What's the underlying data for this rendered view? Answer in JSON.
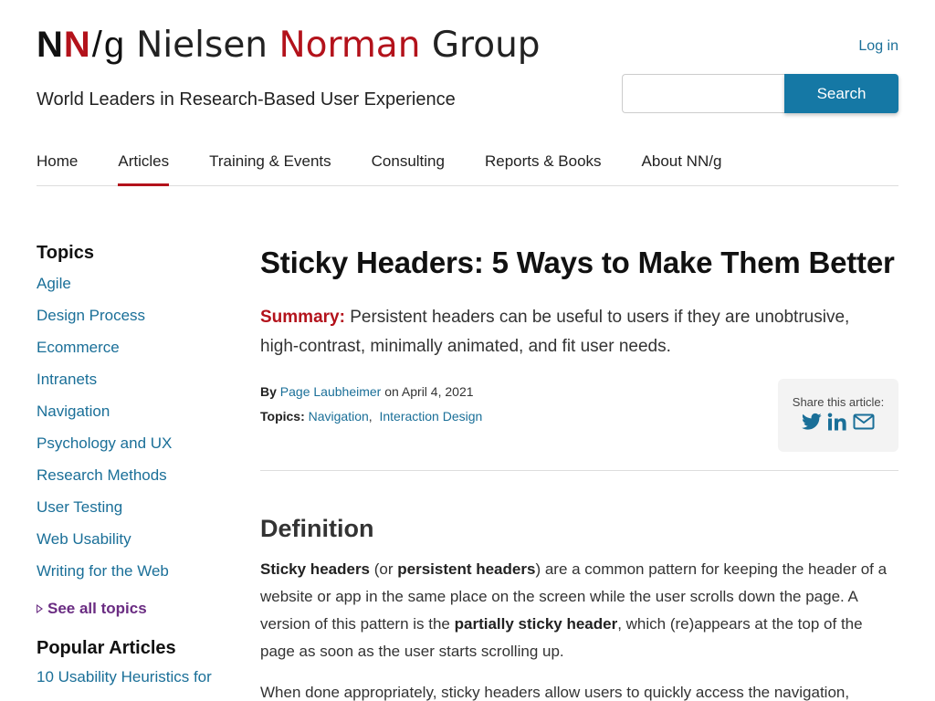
{
  "header": {
    "logo_mark": {
      "n1": "N",
      "n2": "N",
      "slash": "/",
      "g": "g"
    },
    "logo_text": {
      "part1": "Nielsen ",
      "part2": "Norman",
      "part3": " Group"
    },
    "tagline": "World Leaders in Research-Based User Experience",
    "login": "Log in",
    "search": {
      "placeholder": "",
      "button": "Search"
    }
  },
  "nav": {
    "items": [
      "Home",
      "Articles",
      "Training & Events",
      "Consulting",
      "Reports & Books",
      "About NN/g"
    ],
    "active": "Articles"
  },
  "sidebar": {
    "topics_heading": "Topics",
    "topics": [
      "Agile",
      "Design Process",
      "Ecommerce",
      "Intranets",
      "Navigation",
      "Psychology and UX",
      "Research Methods",
      "User Testing",
      "Web Usability",
      "Writing for the Web"
    ],
    "see_all": "See all topics",
    "popular_heading": "Popular Articles",
    "popular_first": "10 Usability Heuristics for"
  },
  "article": {
    "title": "Sticky Headers: 5 Ways to Make Them Better",
    "summary_label": "Summary:",
    "summary_text": "Persistent headers can be useful to users if they are unobtrusive, high-contrast, minimally animated, and fit user needs.",
    "by_label": "By",
    "author": "Page Laubheimer",
    "date_text": "on April 4, 2021",
    "topics_label": "Topics:",
    "topics": [
      "Navigation",
      "Interaction Design"
    ],
    "topic_sep": ",",
    "share_label": "Share this article:",
    "share_icons": [
      "twitter-icon",
      "linkedin-icon",
      "email-icon"
    ],
    "section_heading": "Definition",
    "para1": {
      "b1": "Sticky headers",
      "t1": " (or ",
      "b2": "persistent headers",
      "t2": ") are a common pattern for keeping the header of a website or app in the same place on the screen while the user scrolls down the page. A version of this pattern is the ",
      "b3": "partially sticky header",
      "t3": ", which (re)appears at the top of the page as soon as the user starts scrolling up."
    },
    "para2": "When done appropriately, sticky headers allow users to quickly access the navigation,"
  },
  "colors": {
    "brand_red": "#b3121b",
    "link_blue": "#1a6f98",
    "button_blue": "#1578a5",
    "see_all_purple": "#6a2c82"
  }
}
